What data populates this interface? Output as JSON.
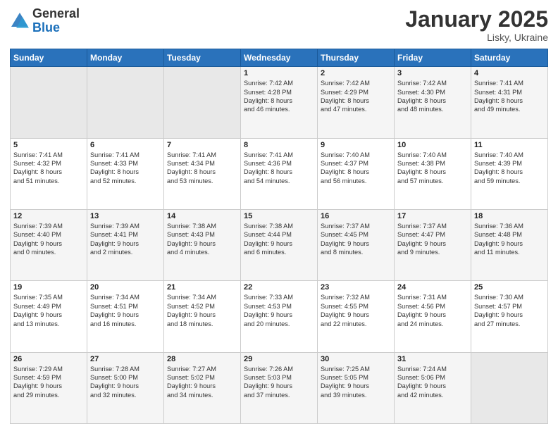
{
  "logo": {
    "general": "General",
    "blue": "Blue"
  },
  "header": {
    "month": "January 2025",
    "location": "Lisky, Ukraine"
  },
  "weekdays": [
    "Sunday",
    "Monday",
    "Tuesday",
    "Wednesday",
    "Thursday",
    "Friday",
    "Saturday"
  ],
  "weeks": [
    [
      {
        "day": "",
        "info": ""
      },
      {
        "day": "",
        "info": ""
      },
      {
        "day": "",
        "info": ""
      },
      {
        "day": "1",
        "info": "Sunrise: 7:42 AM\nSunset: 4:28 PM\nDaylight: 8 hours\nand 46 minutes."
      },
      {
        "day": "2",
        "info": "Sunrise: 7:42 AM\nSunset: 4:29 PM\nDaylight: 8 hours\nand 47 minutes."
      },
      {
        "day": "3",
        "info": "Sunrise: 7:42 AM\nSunset: 4:30 PM\nDaylight: 8 hours\nand 48 minutes."
      },
      {
        "day": "4",
        "info": "Sunrise: 7:41 AM\nSunset: 4:31 PM\nDaylight: 8 hours\nand 49 minutes."
      }
    ],
    [
      {
        "day": "5",
        "info": "Sunrise: 7:41 AM\nSunset: 4:32 PM\nDaylight: 8 hours\nand 51 minutes."
      },
      {
        "day": "6",
        "info": "Sunrise: 7:41 AM\nSunset: 4:33 PM\nDaylight: 8 hours\nand 52 minutes."
      },
      {
        "day": "7",
        "info": "Sunrise: 7:41 AM\nSunset: 4:34 PM\nDaylight: 8 hours\nand 53 minutes."
      },
      {
        "day": "8",
        "info": "Sunrise: 7:41 AM\nSunset: 4:36 PM\nDaylight: 8 hours\nand 54 minutes."
      },
      {
        "day": "9",
        "info": "Sunrise: 7:40 AM\nSunset: 4:37 PM\nDaylight: 8 hours\nand 56 minutes."
      },
      {
        "day": "10",
        "info": "Sunrise: 7:40 AM\nSunset: 4:38 PM\nDaylight: 8 hours\nand 57 minutes."
      },
      {
        "day": "11",
        "info": "Sunrise: 7:40 AM\nSunset: 4:39 PM\nDaylight: 8 hours\nand 59 minutes."
      }
    ],
    [
      {
        "day": "12",
        "info": "Sunrise: 7:39 AM\nSunset: 4:40 PM\nDaylight: 9 hours\nand 0 minutes."
      },
      {
        "day": "13",
        "info": "Sunrise: 7:39 AM\nSunset: 4:41 PM\nDaylight: 9 hours\nand 2 minutes."
      },
      {
        "day": "14",
        "info": "Sunrise: 7:38 AM\nSunset: 4:43 PM\nDaylight: 9 hours\nand 4 minutes."
      },
      {
        "day": "15",
        "info": "Sunrise: 7:38 AM\nSunset: 4:44 PM\nDaylight: 9 hours\nand 6 minutes."
      },
      {
        "day": "16",
        "info": "Sunrise: 7:37 AM\nSunset: 4:45 PM\nDaylight: 9 hours\nand 8 minutes."
      },
      {
        "day": "17",
        "info": "Sunrise: 7:37 AM\nSunset: 4:47 PM\nDaylight: 9 hours\nand 9 minutes."
      },
      {
        "day": "18",
        "info": "Sunrise: 7:36 AM\nSunset: 4:48 PM\nDaylight: 9 hours\nand 11 minutes."
      }
    ],
    [
      {
        "day": "19",
        "info": "Sunrise: 7:35 AM\nSunset: 4:49 PM\nDaylight: 9 hours\nand 13 minutes."
      },
      {
        "day": "20",
        "info": "Sunrise: 7:34 AM\nSunset: 4:51 PM\nDaylight: 9 hours\nand 16 minutes."
      },
      {
        "day": "21",
        "info": "Sunrise: 7:34 AM\nSunset: 4:52 PM\nDaylight: 9 hours\nand 18 minutes."
      },
      {
        "day": "22",
        "info": "Sunrise: 7:33 AM\nSunset: 4:53 PM\nDaylight: 9 hours\nand 20 minutes."
      },
      {
        "day": "23",
        "info": "Sunrise: 7:32 AM\nSunset: 4:55 PM\nDaylight: 9 hours\nand 22 minutes."
      },
      {
        "day": "24",
        "info": "Sunrise: 7:31 AM\nSunset: 4:56 PM\nDaylight: 9 hours\nand 24 minutes."
      },
      {
        "day": "25",
        "info": "Sunrise: 7:30 AM\nSunset: 4:57 PM\nDaylight: 9 hours\nand 27 minutes."
      }
    ],
    [
      {
        "day": "26",
        "info": "Sunrise: 7:29 AM\nSunset: 4:59 PM\nDaylight: 9 hours\nand 29 minutes."
      },
      {
        "day": "27",
        "info": "Sunrise: 7:28 AM\nSunset: 5:00 PM\nDaylight: 9 hours\nand 32 minutes."
      },
      {
        "day": "28",
        "info": "Sunrise: 7:27 AM\nSunset: 5:02 PM\nDaylight: 9 hours\nand 34 minutes."
      },
      {
        "day": "29",
        "info": "Sunrise: 7:26 AM\nSunset: 5:03 PM\nDaylight: 9 hours\nand 37 minutes."
      },
      {
        "day": "30",
        "info": "Sunrise: 7:25 AM\nSunset: 5:05 PM\nDaylight: 9 hours\nand 39 minutes."
      },
      {
        "day": "31",
        "info": "Sunrise: 7:24 AM\nSunset: 5:06 PM\nDaylight: 9 hours\nand 42 minutes."
      },
      {
        "day": "",
        "info": ""
      }
    ]
  ]
}
